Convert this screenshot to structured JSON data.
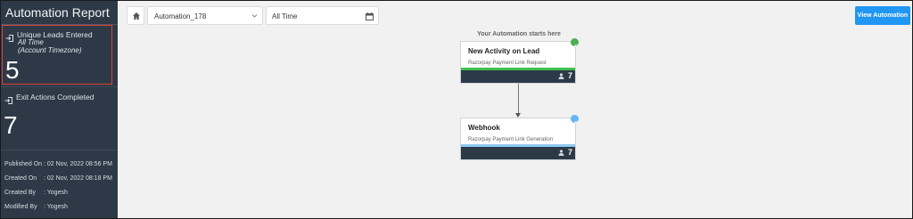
{
  "sidebar": {
    "title": "Automation Report",
    "metrics": [
      {
        "label": "Unique Leads Entered",
        "sub1": "All Time",
        "sub2": "(Account Timezone)",
        "value": "5",
        "icon": "enter-icon"
      },
      {
        "label": "Exit Actions Completed",
        "value": "7",
        "icon": "exit-icon"
      }
    ],
    "info": [
      {
        "label": "Published On",
        "value": ": 02 Nov, 2022 08:56 PM"
      },
      {
        "label": "Created On",
        "value": ": 02 Nov, 2022 08:18 PM"
      },
      {
        "label": "Created By",
        "value": ": Yogesh"
      },
      {
        "label": "Modified By",
        "value": ": Yogesh"
      }
    ]
  },
  "toolbar": {
    "home_icon": "home-icon",
    "automation_select": {
      "value": "Automation_178",
      "icon": "chevron-down-icon"
    },
    "date_filter": {
      "value": "All Time",
      "icon": "calendar-icon"
    },
    "view_button": "View Automation"
  },
  "canvas": {
    "start_label": "Your Automation starts here",
    "nodes": [
      {
        "title": "New Activity on Lead",
        "subtitle": "Razorpay Payment Link Request",
        "count": "7",
        "bar_color": "#3fbf4f",
        "badge_color": "#4caf50",
        "badge_icon": "check-icon"
      },
      {
        "title": "Webhook",
        "subtitle": "Razorpay Payment Link Generation",
        "count": "7",
        "bar_color": "#8ec9f2",
        "badge_color": "#64b5f6",
        "badge_icon": "check-icon"
      }
    ]
  },
  "colors": {
    "sidebar_bg": "#2d3946",
    "accent": "#2196f3",
    "highlight_border": "#e0413b"
  }
}
